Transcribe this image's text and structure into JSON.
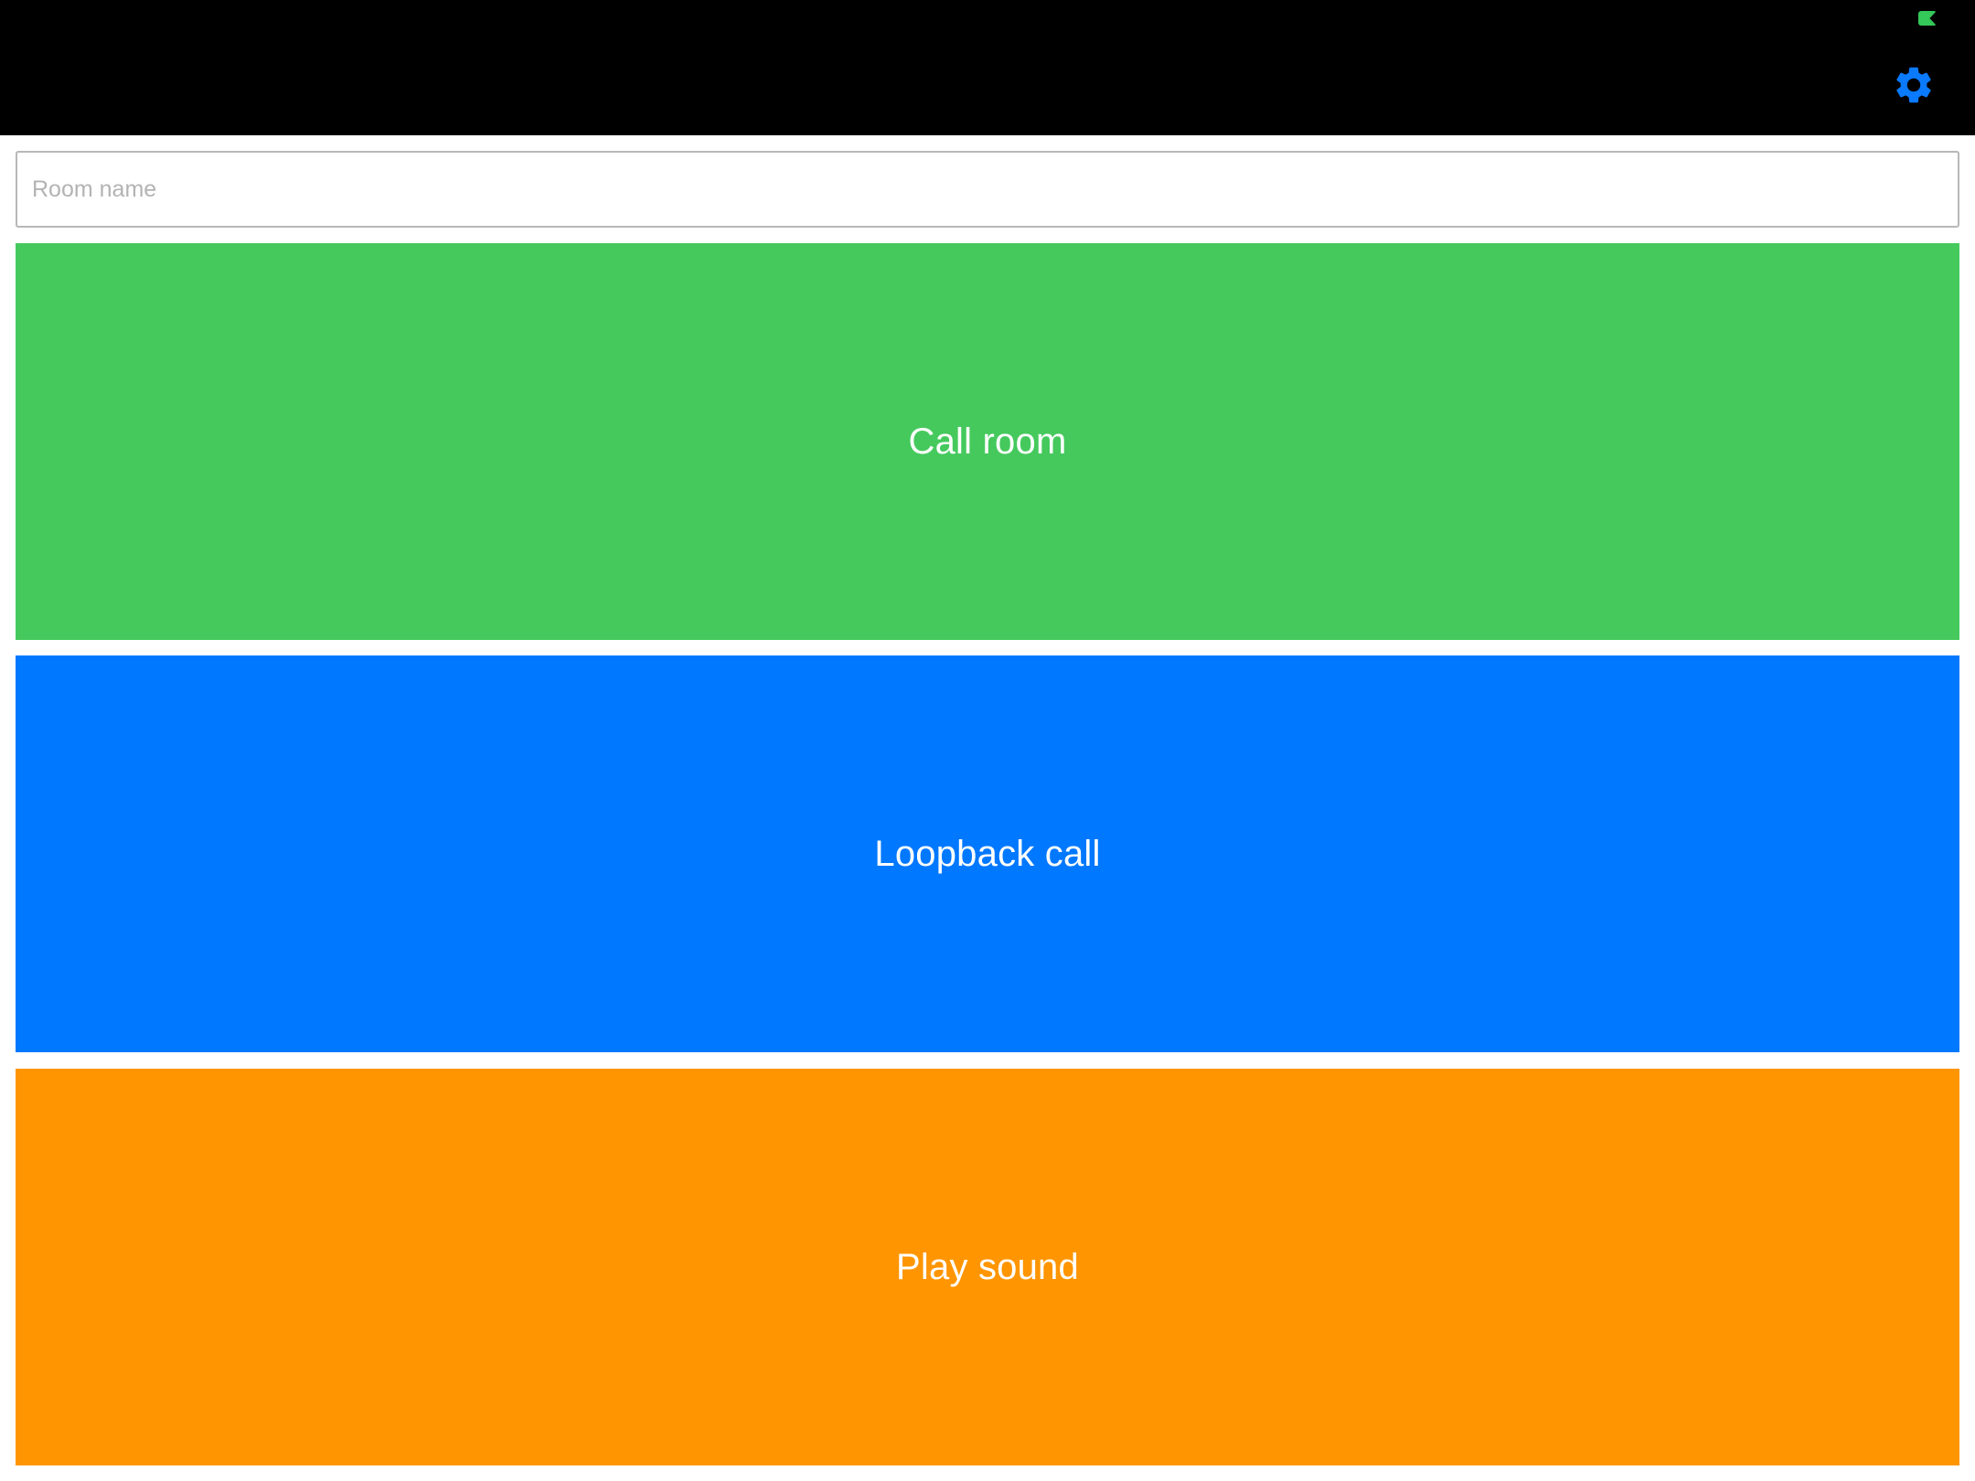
{
  "colors": {
    "top_bar": "#000000",
    "status_indicator": "#34c759",
    "settings_icon": "#0a7aff",
    "call_room": "#45c95d",
    "loopback_call": "#0078ff",
    "play_sound": "#ff9500"
  },
  "header": {
    "settings_icon": "gear-icon",
    "status_icon": "flag-indicator"
  },
  "room": {
    "placeholder": "Room name",
    "value": ""
  },
  "buttons": {
    "call_room": "Call room",
    "loopback_call": "Loopback call",
    "play_sound": "Play sound"
  }
}
